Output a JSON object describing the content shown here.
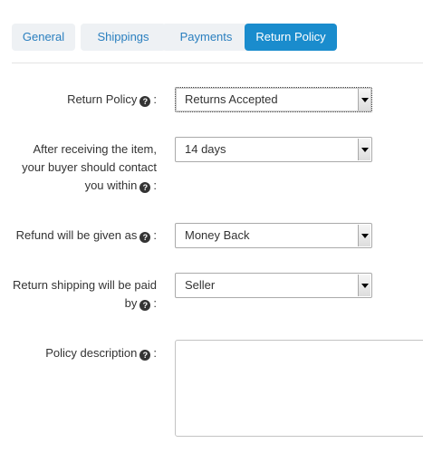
{
  "tabs": [
    {
      "label": "General",
      "active": false
    },
    {
      "label": "Shippings",
      "active": false
    },
    {
      "label": "Payments",
      "active": false
    },
    {
      "label": "Return Policy",
      "active": true
    }
  ],
  "form": {
    "return_policy": {
      "label": "Return Policy",
      "value": "Returns Accepted"
    },
    "contact_within": {
      "label_line1": "After receiving the item,",
      "label_line2": "your buyer should contact",
      "label_line3": "you within",
      "value": "14 days"
    },
    "refund": {
      "label": "Refund will be given as",
      "value": "Money Back"
    },
    "return_shipping": {
      "label_line1": "Return shipping will be paid",
      "label_line2": "by",
      "value": "Seller"
    },
    "description": {
      "label": "Policy description",
      "value": ""
    }
  },
  "help_glyph": "?",
  "colon": ":",
  "colors": {
    "accent": "#1a8ccd",
    "tab_text": "#2a7fbf",
    "tab_bg": "#eef1f4"
  },
  "icons": {
    "help": "question-circle-icon",
    "dropdown": "triangle-down-icon"
  }
}
